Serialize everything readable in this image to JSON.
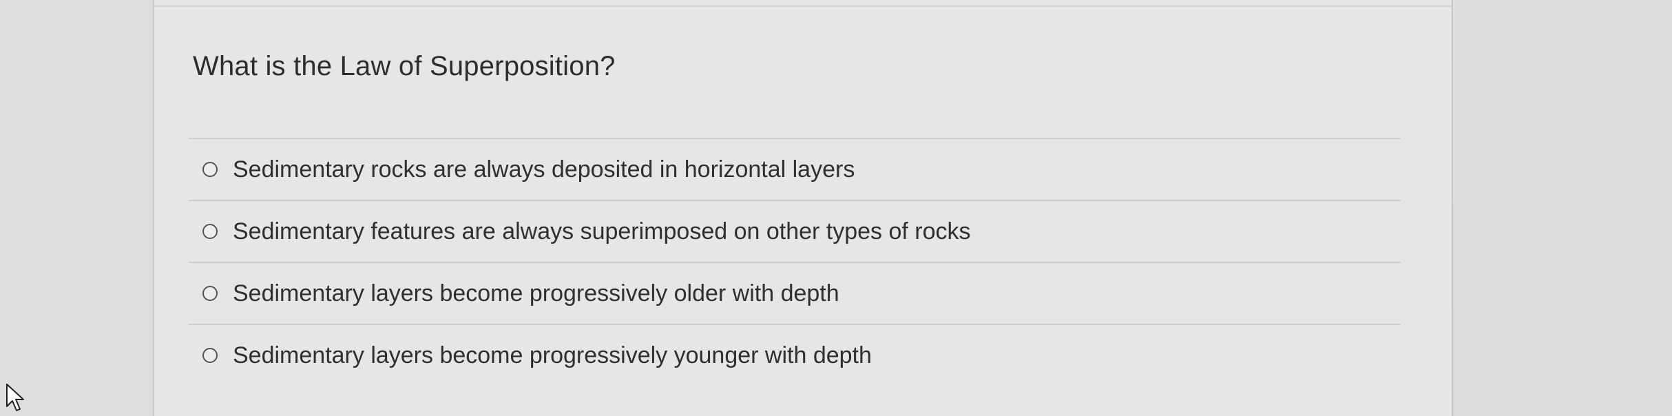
{
  "question": {
    "text": "What is the Law of Superposition?"
  },
  "answers": [
    {
      "label": "Sedimentary rocks are always deposited in horizontal layers",
      "selected": false
    },
    {
      "label": "Sedimentary features are always superimposed on other types of rocks",
      "selected": false
    },
    {
      "label": "Sedimentary layers become progressively older with depth",
      "selected": false
    },
    {
      "label": "Sedimentary layers become progressively younger with depth",
      "selected": false
    }
  ],
  "colors": {
    "background": "#dcdcdb",
    "card": "#e6e6e5",
    "text": "#2d2d2d",
    "divider": "#cdcdcc"
  },
  "icons": {
    "radio": "radio-unchecked-icon",
    "cursor": "mouse-pointer-icon"
  }
}
